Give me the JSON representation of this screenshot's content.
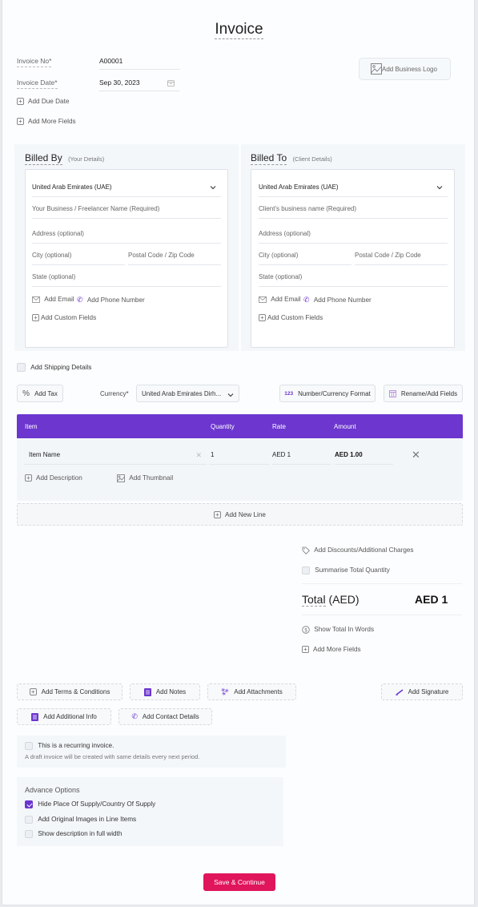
{
  "header": {
    "title": "Invoice"
  },
  "meta": {
    "invoice_no_label": "Invoice No*",
    "invoice_no_value": "A00001",
    "invoice_date_label": "Invoice Date*",
    "invoice_date_value": "Sep 30, 2023",
    "add_due_date": "Add Due Date",
    "add_more_fields": "Add More Fields",
    "add_logo": "Add Business Logo"
  },
  "billed_by": {
    "title": "Billed By",
    "subtitle": "(Your Details)",
    "country": "United Arab Emirates (UAE)",
    "name_placeholder": "Your Business / Freelancer Name (Required)",
    "address_placeholder": "Address (optional)",
    "city_placeholder": "City (optional)",
    "postal_placeholder": "Postal Code / Zip Code",
    "state_placeholder": "State (optional)",
    "add_email": "Add Email",
    "add_phone": "Add Phone Number",
    "add_custom": "Add Custom Fields"
  },
  "billed_to": {
    "title": "Billed To",
    "subtitle": "(Client Details)",
    "country": "United Arab Emirates (UAE)",
    "name_placeholder": "Client's business name (Required)",
    "address_placeholder": "Address (optional)",
    "city_placeholder": "City (optional)",
    "postal_placeholder": "Postal Code / Zip Code",
    "state_placeholder": "State (optional)",
    "add_email": "Add Email",
    "add_phone": "Add Phone Number",
    "add_custom": "Add Custom Fields"
  },
  "shipping": {
    "label": "Add Shipping Details",
    "checked": false
  },
  "toolbar": {
    "add_tax": "Add Tax",
    "currency_label": "Currency*",
    "currency_value": "United Arab Emirates Dirh...",
    "number_format": "Number/Currency Format",
    "number_format_icon_text": "123",
    "rename_fields": "Rename/Add Fields"
  },
  "items_table": {
    "columns": [
      "Item",
      "Quantity",
      "Rate",
      "Amount"
    ],
    "rows": [
      {
        "item": "Item Name",
        "quantity": "1",
        "rate": "AED 1",
        "amount": "AED 1.00"
      }
    ],
    "add_description": "Add Description",
    "add_thumbnail": "Add Thumbnail",
    "add_new_line": "Add New Line"
  },
  "summary": {
    "add_discounts": "Add Discounts/Additional Charges",
    "summarise_qty": "Summarise Total Quantity",
    "total_label": "Total",
    "total_currency": "(AED)",
    "total_value": "AED 1",
    "show_words": "Show Total In Words",
    "add_more_fields": "Add More Fields"
  },
  "actions": {
    "terms": "Add Terms & Conditions",
    "notes": "Add Notes",
    "attachments": "Add Attachments",
    "signature": "Add Signature",
    "additional_info": "Add Additional Info",
    "contact_details": "Add Contact Details"
  },
  "recurring": {
    "label": "This is a recurring invoice.",
    "hint": "A draft invoice will be created with same details every next period.",
    "checked": false
  },
  "advance": {
    "title": "Advance Options",
    "options": [
      {
        "label": "Hide Place Of Supply/Country Of Supply",
        "checked": true
      },
      {
        "label": "Add Original Images in Line Items",
        "checked": false
      },
      {
        "label": "Show description in full width",
        "checked": false
      }
    ]
  },
  "footer": {
    "save": "Save & Continue"
  },
  "colors": {
    "accent": "#6c36cf",
    "primary_button": "#e0155b"
  }
}
